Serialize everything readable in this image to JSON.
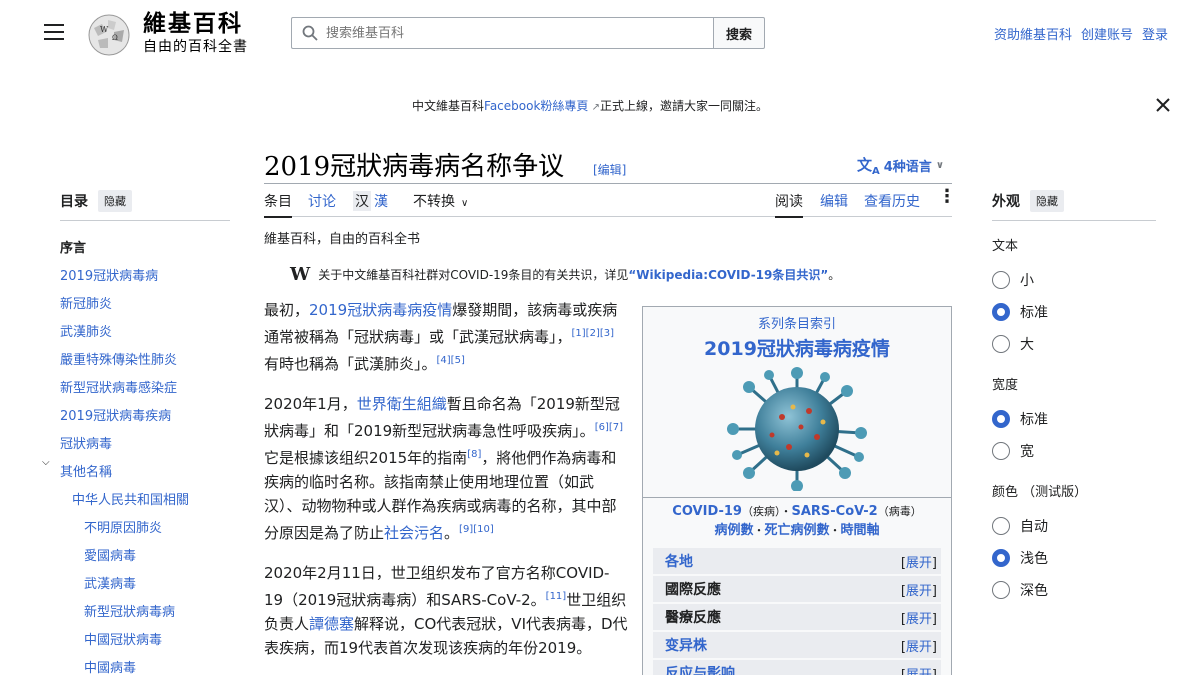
{
  "header": {
    "site_name": "維基百科",
    "site_tagline": "自由的百科全書",
    "search_placeholder": "搜索维基百科",
    "search_button": "搜索",
    "user_links": [
      "资助維基百科",
      "创建账号",
      "登录"
    ]
  },
  "banner": {
    "prefix": "中文維基百科",
    "link": "Facebook粉絲專頁",
    "suffix": "正式上線，邀請大家一同關注。"
  },
  "toc": {
    "title": "目录",
    "hide": "隐藏",
    "items": [
      {
        "label": "序言",
        "level": 1,
        "current": true
      },
      {
        "label": "2019冠狀病毒病",
        "level": 1
      },
      {
        "label": "新冠肺炎",
        "level": 1
      },
      {
        "label": "武漢肺炎",
        "level": 1
      },
      {
        "label": "嚴重特殊傳染性肺炎",
        "level": 1
      },
      {
        "label": "新型冠狀病毒感染症",
        "level": 1
      },
      {
        "label": "2019冠狀病毒疾病",
        "level": 1
      },
      {
        "label": "冠狀病毒",
        "level": 1
      },
      {
        "label": "其他名稱",
        "level": 1
      },
      {
        "label": "中华人民共和国相關",
        "level": 2
      },
      {
        "label": "不明原因肺炎",
        "level": 3
      },
      {
        "label": "愛國病毒",
        "level": 3
      },
      {
        "label": "武漢病毒",
        "level": 3
      },
      {
        "label": "新型冠狀病毒病",
        "level": 3
      },
      {
        "label": "中國冠狀病毒",
        "level": 3
      },
      {
        "label": "中國病毒",
        "level": 3
      }
    ]
  },
  "article": {
    "title": "2019冠狀病毒病名称争议",
    "edit_link": "[编辑]",
    "languages": "4种语言",
    "tabs_left": [
      "条目",
      "讨论",
      "汉",
      "漢",
      "不转换"
    ],
    "tabs_right": [
      "阅读",
      "编辑",
      "查看历史"
    ],
    "tagline": "維基百科，自由的百科全书",
    "notice": {
      "prefix": "关于中文維基百科社群对COVID-19条目的有关共识，详见",
      "link": "“Wikipedia:COVID-19条目共识”",
      "suffix": "。"
    },
    "p1": {
      "a": "最初，",
      "link": "2019冠狀病毒病疫情",
      "b": "爆發期間，該病毒或疾病通常被稱為「冠狀病毒」或「武漢冠狀病毒」，",
      "refs1": "[1][2][3]",
      "c": "有時也稱為「武漢肺炎」。",
      "refs2": "[4][5]"
    },
    "p2": {
      "a": "2020年1月，",
      "link": "世界衛生組織",
      "b": "暫且命名為「2019新型冠狀病毒」和「2019新型冠狀病毒急性呼吸疾病」。",
      "refs1": "[6][7]",
      "c": "它是根據该组织2015年的指南",
      "refs2": "[8]",
      "d": "，將他們作為病毒和疾病的临时名称。該指南禁止使用地理位置（如武汉）、动物物种或人群作為疾病或病毒的名称，其中部分原因是為了防止",
      "link2": "社会污名",
      "e": "。",
      "refs3": "[9][10]"
    },
    "p3": {
      "a": "2020年2月11日，世卫组织发布了官方名称COVID-19（2019冠狀病毒病）和SARS-CoV-2。",
      "refs1": "[11]",
      "b": "世卫组织负责人",
      "link": "譚德塞",
      "c": "解释说，CO代表冠狀，VI代表病毒，D代表疾病，而19代表首次发现该疾病的年份2019。"
    }
  },
  "infobox": {
    "series": "系列条目索引",
    "title": "2019冠狀病毒病疫情",
    "link_covid": "COVID-19",
    "label_disease": "（疾病）",
    "dot1": "・",
    "link_sars": "SARS-CoV-2",
    "label_virus": "（病毒）",
    "link_cases": "病例數",
    "dot2": "・",
    "link_deaths": "死亡病例數",
    "dot3": "・",
    "link_timeline": "時間軸",
    "rows": [
      {
        "label": "各地",
        "link": true
      },
      {
        "label": "國際反應",
        "link": false
      },
      {
        "label": "醫療反應",
        "link": false
      },
      {
        "label": "变异株",
        "link": true
      },
      {
        "label": "反应与影响",
        "link": true
      }
    ],
    "expand": "展开"
  },
  "appearance": {
    "title": "外观",
    "hide": "隐藏",
    "groups": [
      {
        "title": "文本",
        "options": [
          "小",
          "标准",
          "大"
        ],
        "selected": 1
      },
      {
        "title": "宽度",
        "options": [
          "标准",
          "宽"
        ],
        "selected": 0
      },
      {
        "title": "颜色 （测试版）",
        "options": [
          "自动",
          "浅色",
          "深色"
        ],
        "selected": 1
      }
    ]
  },
  "colors": {
    "link": "#3366cc",
    "accent": "#3366cc",
    "text": "#202122"
  }
}
